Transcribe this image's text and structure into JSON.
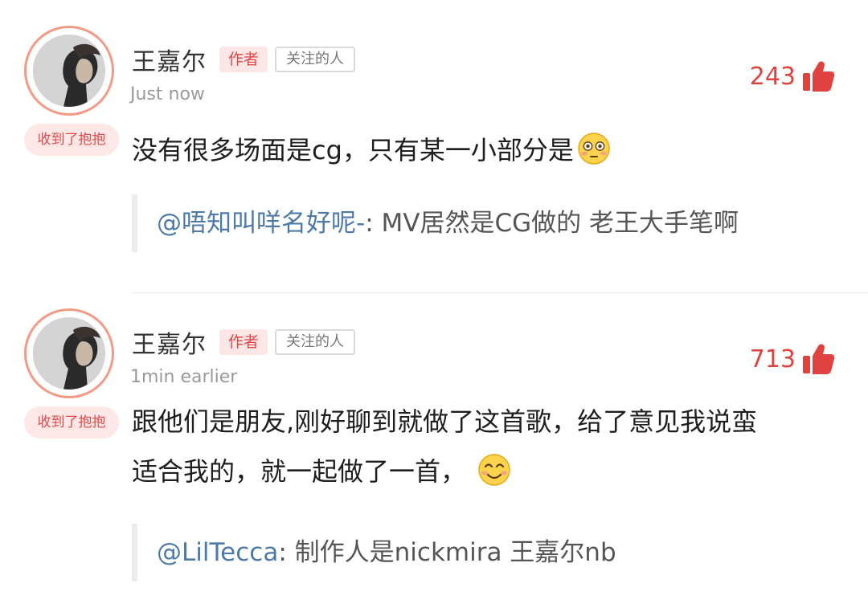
{
  "comments": [
    {
      "author": "王嘉尔",
      "author_tag": "作者",
      "follow_tag": "关注的人",
      "time": "Just now",
      "likes": "243",
      "badge": "收到了抱抱",
      "text": "没有很多场面是cg，只有某一小部分是",
      "emoji": "flushed-face-icon",
      "quote_user": "@唔知叫咩名好呢-",
      "quote_sep": ":",
      "quote_text": " MV居然是CG做的 老王大手笔啊"
    },
    {
      "author": "王嘉尔",
      "author_tag": "作者",
      "follow_tag": "关注的人",
      "time": "1min earlier",
      "likes": "713",
      "badge": "收到了抱抱",
      "text_line1": "跟他们是朋友,刚好聊到就做了这首歌，给了意见我说蛮",
      "text_line2": "适合我的，就一起做了一首，",
      "emoji": "smiling-face-icon",
      "quote_user": "@LilTecca",
      "quote_sep": ":",
      "quote_text": " 制作人是nickmira 王嘉尔nb"
    }
  ],
  "colors": {
    "accent": "#e0433f",
    "link": "#4d7aa8",
    "badge_bg": "#fde7e7"
  }
}
